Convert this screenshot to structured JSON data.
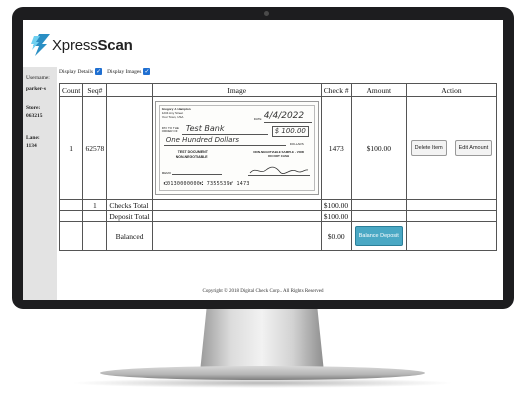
{
  "app": {
    "logo_text_light": "Xpress",
    "logo_text_bold": "Scan"
  },
  "sidebar": {
    "username_label": "Username:",
    "username_value": "parker-s",
    "store_label": "Store:",
    "store_value": "063215",
    "lane_label": "Lane:",
    "lane_value": "1134"
  },
  "options": {
    "display_details": "Display Details",
    "display_images": "Display Images"
  },
  "table": {
    "headers": [
      "Count",
      "Seq#",
      "",
      "Image",
      "Check #",
      "Amount",
      "Action"
    ],
    "row": {
      "count": "1",
      "seq": "62578",
      "check_no": "1473",
      "amount": "$100.00",
      "delete_button": "Delete Item",
      "edit_button": "Edit Amount"
    },
    "checks_total": {
      "count": "1",
      "label": "Checks Total",
      "amount": "$100.00"
    },
    "deposit_total": {
      "label": "Deposit Total",
      "amount": "$100.00"
    },
    "balanced": {
      "label": "Balanced",
      "amount": "$0.00",
      "button": "Balance Deposit"
    }
  },
  "check_image": {
    "payer_name": "Gregory J. Hampton",
    "payer_addr1": "1234 Any Street",
    "payer_addr2": "Your Town, USA",
    "date_label": "DATE",
    "date_value": "4/4/2022",
    "pay_to_label": "PAY TO THE ORDER OF",
    "payee": "Test Bank",
    "amount_box": "$ 100.00",
    "amount_words": "One Hundred Dollars",
    "dollars_label": "DOLLARS",
    "test_doc": "TEST DOCUMENT",
    "non_negotiable": "NON-NEGOTIABLE",
    "sample": "NON-NEGOTIABLE SAMPLE - VOID DO NOT CASH",
    "memo_label": "MEMO",
    "micr": "⑆0130000000⑆ 7355539⑈ 1473"
  },
  "footer": {
    "copyright": "Copyright © 2018 Digital Check Corp.. All Rights Reserved"
  }
}
